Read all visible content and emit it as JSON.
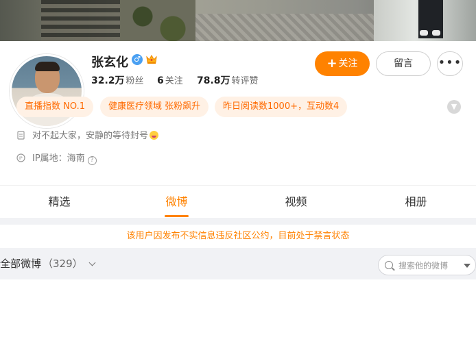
{
  "profile": {
    "name": "张玄化",
    "gender_icon": "male-icon",
    "badge_icon": "crown-icon",
    "gender_glyph": "♂",
    "stats": [
      {
        "value": "32.2万",
        "label": "粉丝"
      },
      {
        "value": "6",
        "label": "关注"
      },
      {
        "value": "78.8万",
        "label": "转评赞"
      }
    ]
  },
  "actions": {
    "follow_plus": "+",
    "follow_label": "关注",
    "message_label": "留言",
    "more_glyph": "•••"
  },
  "tags": [
    "直播指数 NO.1",
    "健康医疗领域 张粉飙升",
    "昨日阅读数1000+，互动数4"
  ],
  "bio": {
    "text": "对不起大家，安静的等待封号",
    "ip_label": "IP属地：海南",
    "help_glyph": "?"
  },
  "tabs": [
    {
      "label": "精选",
      "active": false
    },
    {
      "label": "微博",
      "active": true
    },
    {
      "label": "视频",
      "active": false
    },
    {
      "label": "相册",
      "active": false
    }
  ],
  "notice": "该用户因发布不实信息违反社区公约，目前处于禁言状态",
  "filter": {
    "label": "全部微博",
    "count": "（329）"
  },
  "search": {
    "placeholder": "搜索他的微博",
    "value": ""
  },
  "colors": {
    "accent": "#ff8200",
    "tag_bg": "#fff1e5",
    "tag_text": "#ff6a00",
    "page_gray": "#f1f2f5"
  }
}
